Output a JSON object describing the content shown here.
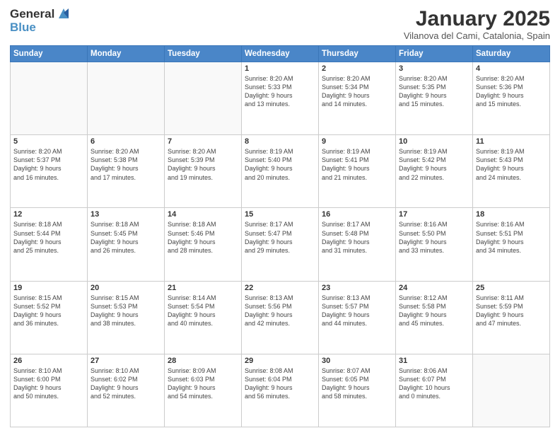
{
  "header": {
    "logo_line1": "General",
    "logo_line2": "Blue",
    "title": "January 2025",
    "subtitle": "Vilanova del Cami, Catalonia, Spain"
  },
  "weekdays": [
    "Sunday",
    "Monday",
    "Tuesday",
    "Wednesday",
    "Thursday",
    "Friday",
    "Saturday"
  ],
  "weeks": [
    [
      {
        "day": "",
        "info": ""
      },
      {
        "day": "",
        "info": ""
      },
      {
        "day": "",
        "info": ""
      },
      {
        "day": "1",
        "info": "Sunrise: 8:20 AM\nSunset: 5:33 PM\nDaylight: 9 hours\nand 13 minutes."
      },
      {
        "day": "2",
        "info": "Sunrise: 8:20 AM\nSunset: 5:34 PM\nDaylight: 9 hours\nand 14 minutes."
      },
      {
        "day": "3",
        "info": "Sunrise: 8:20 AM\nSunset: 5:35 PM\nDaylight: 9 hours\nand 15 minutes."
      },
      {
        "day": "4",
        "info": "Sunrise: 8:20 AM\nSunset: 5:36 PM\nDaylight: 9 hours\nand 15 minutes."
      }
    ],
    [
      {
        "day": "5",
        "info": "Sunrise: 8:20 AM\nSunset: 5:37 PM\nDaylight: 9 hours\nand 16 minutes."
      },
      {
        "day": "6",
        "info": "Sunrise: 8:20 AM\nSunset: 5:38 PM\nDaylight: 9 hours\nand 17 minutes."
      },
      {
        "day": "7",
        "info": "Sunrise: 8:20 AM\nSunset: 5:39 PM\nDaylight: 9 hours\nand 19 minutes."
      },
      {
        "day": "8",
        "info": "Sunrise: 8:19 AM\nSunset: 5:40 PM\nDaylight: 9 hours\nand 20 minutes."
      },
      {
        "day": "9",
        "info": "Sunrise: 8:19 AM\nSunset: 5:41 PM\nDaylight: 9 hours\nand 21 minutes."
      },
      {
        "day": "10",
        "info": "Sunrise: 8:19 AM\nSunset: 5:42 PM\nDaylight: 9 hours\nand 22 minutes."
      },
      {
        "day": "11",
        "info": "Sunrise: 8:19 AM\nSunset: 5:43 PM\nDaylight: 9 hours\nand 24 minutes."
      }
    ],
    [
      {
        "day": "12",
        "info": "Sunrise: 8:18 AM\nSunset: 5:44 PM\nDaylight: 9 hours\nand 25 minutes."
      },
      {
        "day": "13",
        "info": "Sunrise: 8:18 AM\nSunset: 5:45 PM\nDaylight: 9 hours\nand 26 minutes."
      },
      {
        "day": "14",
        "info": "Sunrise: 8:18 AM\nSunset: 5:46 PM\nDaylight: 9 hours\nand 28 minutes."
      },
      {
        "day": "15",
        "info": "Sunrise: 8:17 AM\nSunset: 5:47 PM\nDaylight: 9 hours\nand 29 minutes."
      },
      {
        "day": "16",
        "info": "Sunrise: 8:17 AM\nSunset: 5:48 PM\nDaylight: 9 hours\nand 31 minutes."
      },
      {
        "day": "17",
        "info": "Sunrise: 8:16 AM\nSunset: 5:50 PM\nDaylight: 9 hours\nand 33 minutes."
      },
      {
        "day": "18",
        "info": "Sunrise: 8:16 AM\nSunset: 5:51 PM\nDaylight: 9 hours\nand 34 minutes."
      }
    ],
    [
      {
        "day": "19",
        "info": "Sunrise: 8:15 AM\nSunset: 5:52 PM\nDaylight: 9 hours\nand 36 minutes."
      },
      {
        "day": "20",
        "info": "Sunrise: 8:15 AM\nSunset: 5:53 PM\nDaylight: 9 hours\nand 38 minutes."
      },
      {
        "day": "21",
        "info": "Sunrise: 8:14 AM\nSunset: 5:54 PM\nDaylight: 9 hours\nand 40 minutes."
      },
      {
        "day": "22",
        "info": "Sunrise: 8:13 AM\nSunset: 5:56 PM\nDaylight: 9 hours\nand 42 minutes."
      },
      {
        "day": "23",
        "info": "Sunrise: 8:13 AM\nSunset: 5:57 PM\nDaylight: 9 hours\nand 44 minutes."
      },
      {
        "day": "24",
        "info": "Sunrise: 8:12 AM\nSunset: 5:58 PM\nDaylight: 9 hours\nand 45 minutes."
      },
      {
        "day": "25",
        "info": "Sunrise: 8:11 AM\nSunset: 5:59 PM\nDaylight: 9 hours\nand 47 minutes."
      }
    ],
    [
      {
        "day": "26",
        "info": "Sunrise: 8:10 AM\nSunset: 6:00 PM\nDaylight: 9 hours\nand 50 minutes."
      },
      {
        "day": "27",
        "info": "Sunrise: 8:10 AM\nSunset: 6:02 PM\nDaylight: 9 hours\nand 52 minutes."
      },
      {
        "day": "28",
        "info": "Sunrise: 8:09 AM\nSunset: 6:03 PM\nDaylight: 9 hours\nand 54 minutes."
      },
      {
        "day": "29",
        "info": "Sunrise: 8:08 AM\nSunset: 6:04 PM\nDaylight: 9 hours\nand 56 minutes."
      },
      {
        "day": "30",
        "info": "Sunrise: 8:07 AM\nSunset: 6:05 PM\nDaylight: 9 hours\nand 58 minutes."
      },
      {
        "day": "31",
        "info": "Sunrise: 8:06 AM\nSunset: 6:07 PM\nDaylight: 10 hours\nand 0 minutes."
      },
      {
        "day": "",
        "info": ""
      }
    ]
  ]
}
